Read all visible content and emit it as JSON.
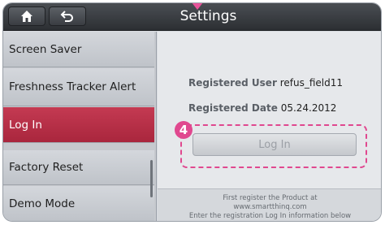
{
  "header": {
    "title": "Settings",
    "home_icon": "home-icon",
    "back_icon": "back-arrow-icon"
  },
  "menu": {
    "items": [
      {
        "label": "Screen Saver",
        "active": false
      },
      {
        "label": "Freshness Tracker Alert",
        "active": false
      },
      {
        "label": "Log In",
        "active": true
      },
      {
        "label": "Factory Reset",
        "active": false
      },
      {
        "label": "Demo Mode",
        "active": false
      }
    ]
  },
  "panel": {
    "registered_user_label": "Registered User",
    "registered_user_value": "refus_field11",
    "registered_date_label": "Registered Date",
    "registered_date_value": "05.24.2012",
    "login_button_label": "Log In",
    "callout_number": "4",
    "footer_lines": [
      "First register the Product at",
      "www.smartthinq.com",
      "Enter the registration Log In information below"
    ]
  },
  "colors": {
    "active_menu": "#b52e46",
    "callout": "#e0488f",
    "titlebar": "#35383c"
  }
}
